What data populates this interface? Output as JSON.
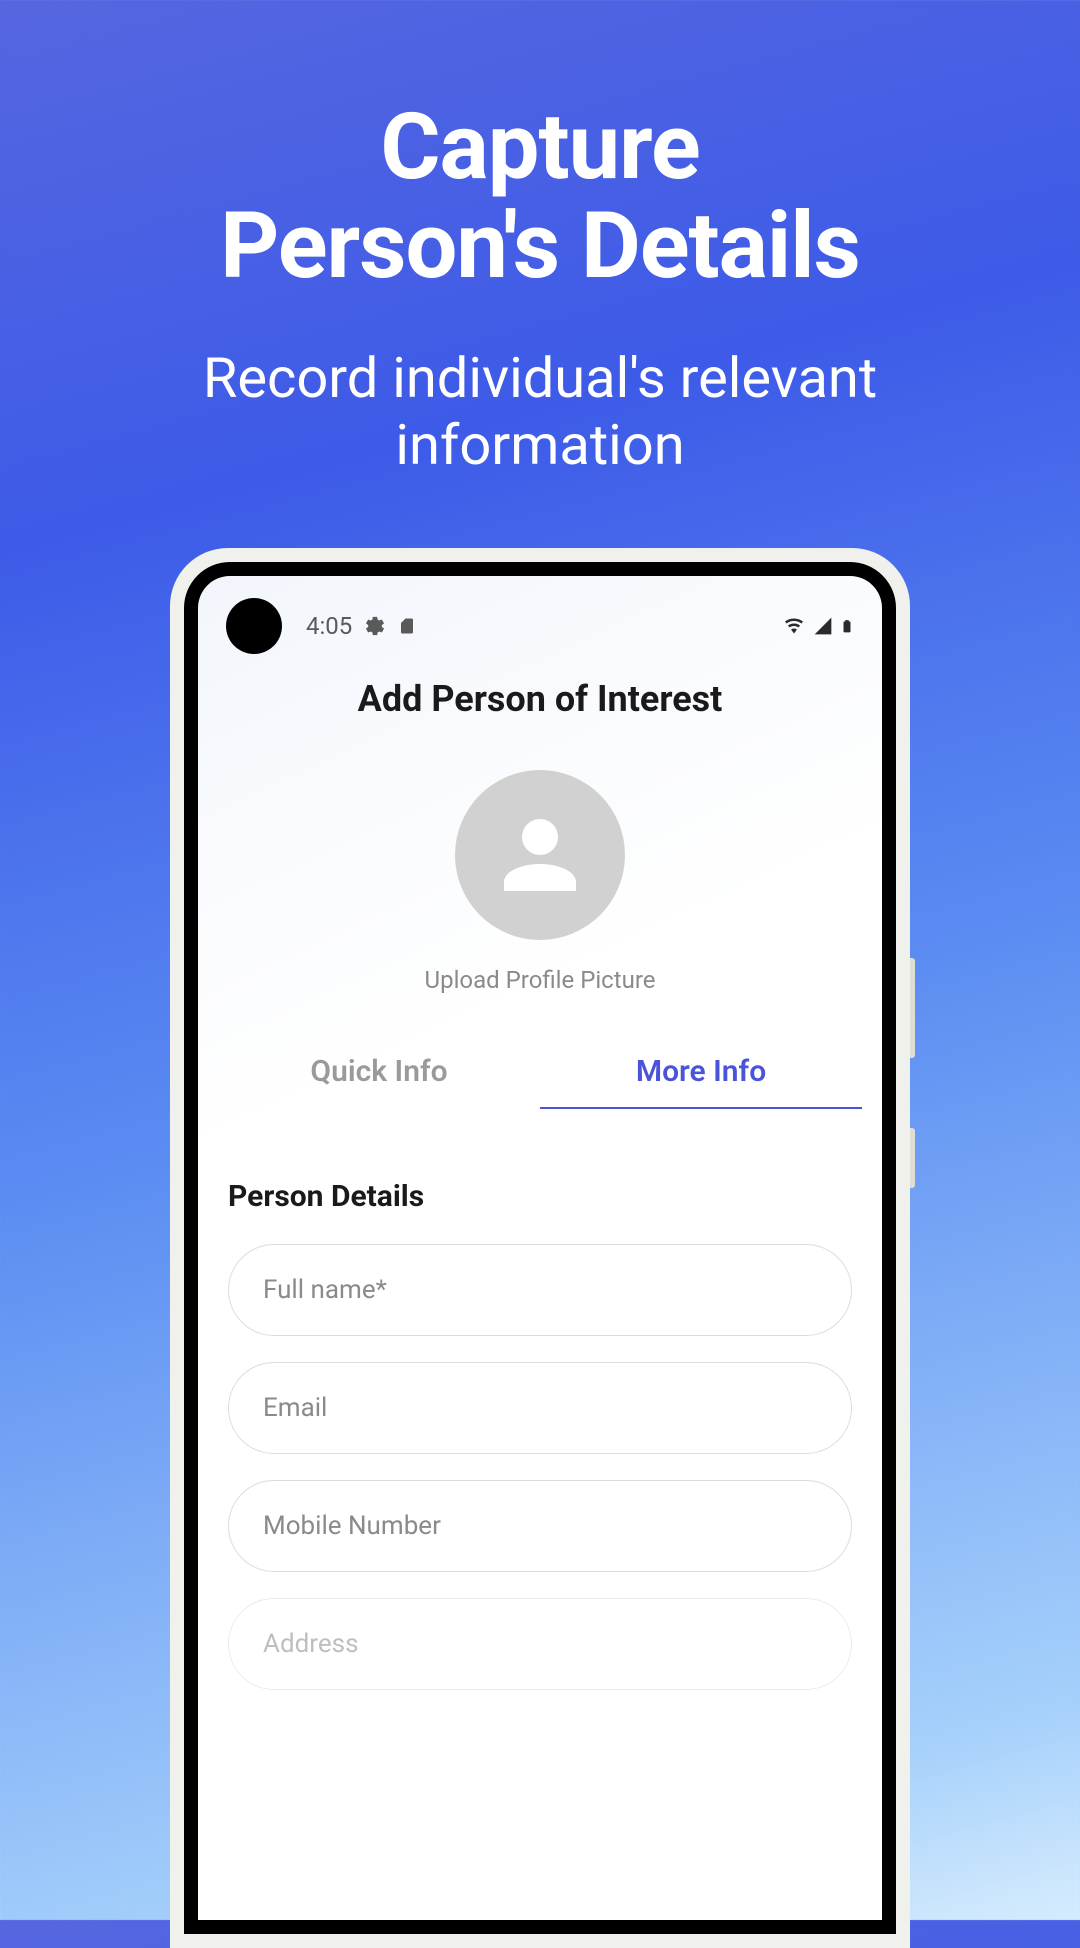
{
  "headline_line1": "Capture",
  "headline_line2": "Person's Details",
  "subheadline_line1": "Record individual's relevant",
  "subheadline_line2": "information",
  "status": {
    "time": "4:05"
  },
  "screen": {
    "title": "Add Person of Interest",
    "upload_label": "Upload Profile Picture",
    "tabs": {
      "quick": "Quick Info",
      "more": "More Info"
    },
    "section_title": "Person Details",
    "fields": {
      "fullname_placeholder": "Full name*",
      "email_placeholder": "Email",
      "mobile_placeholder": "Mobile Number",
      "address_placeholder": "Address"
    }
  }
}
